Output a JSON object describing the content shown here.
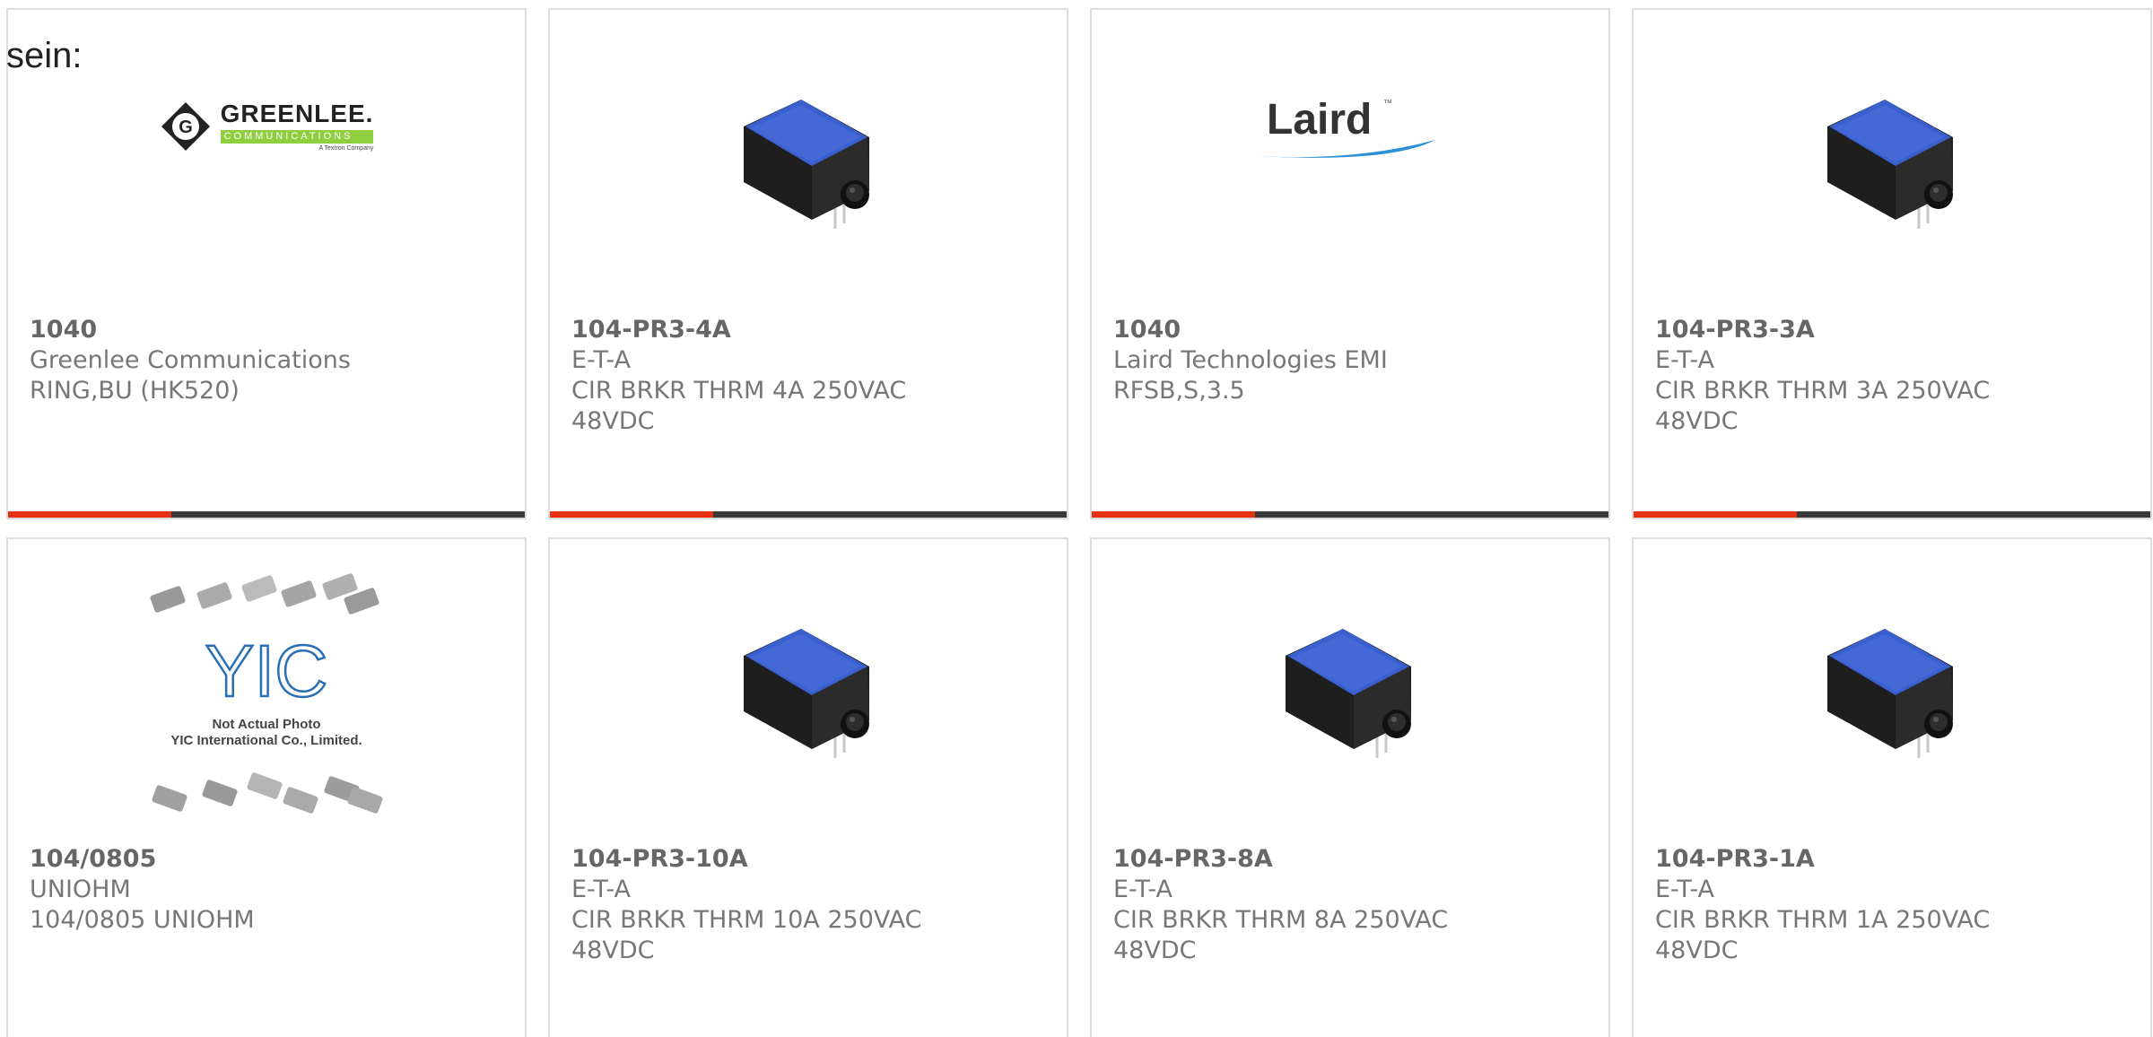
{
  "overlay_text": "sein:",
  "colors": {
    "accent": "#e63212",
    "bar": "#3a3a3a",
    "card_border": "#dddddd",
    "text": "#777777",
    "breaker_blue": "#3a5fcf"
  },
  "products": [
    {
      "part": "1040",
      "manufacturer": "Greenlee Communications",
      "description": "RING,BU (HK520)",
      "image": "greenlee-logo",
      "logo": {
        "name": "GREENLEE.",
        "sub": "COMMUNICATIONS",
        "tag": "A Textron Company",
        "mark": "G"
      }
    },
    {
      "part": "104-PR3-4A",
      "manufacturer": "E-T-A",
      "description": "CIR BRKR THRM 4A 250VAC 48VDC",
      "image": "circuit-breaker"
    },
    {
      "part": "1040",
      "manufacturer": "Laird Technologies EMI",
      "description": "RFSB,S,3.5",
      "image": "laird-logo",
      "logo": {
        "name": "Laird",
        "tm": "™"
      }
    },
    {
      "part": "104-PR3-3A",
      "manufacturer": "E-T-A",
      "description": "CIR BRKR THRM 3A 250VAC 48VDC",
      "image": "circuit-breaker"
    },
    {
      "part": "104/0805",
      "manufacturer": "UNIOHM",
      "description": "104/0805 UNIOHM",
      "image": "yic-placeholder",
      "logo": {
        "mark": "YIC",
        "line1": "Not Actual Photo",
        "line2": "YIC International Co., Limited."
      }
    },
    {
      "part": "104-PR3-10A",
      "manufacturer": "E-T-A",
      "description": "CIR BRKR THRM 10A 250VAC 48VDC",
      "image": "circuit-breaker"
    },
    {
      "part": "104-PR3-8A",
      "manufacturer": "E-T-A",
      "description": "CIR BRKR THRM 8A 250VAC 48VDC",
      "image": "circuit-breaker"
    },
    {
      "part": "104-PR3-1A",
      "manufacturer": "E-T-A",
      "description": "CIR BRKR THRM 1A 250VAC 48VDC",
      "image": "circuit-breaker"
    }
  ]
}
